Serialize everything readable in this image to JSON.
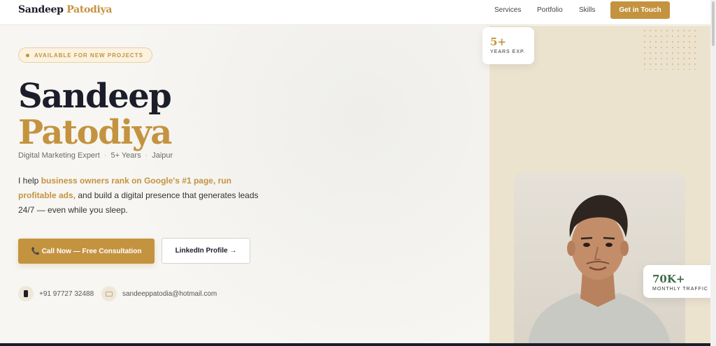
{
  "nav": {
    "brand_first": "Sandeep",
    "brand_last": "Patodiya",
    "links": [
      "Services",
      "Portfolio",
      "Skills"
    ],
    "cta_label": "Get in Touch"
  },
  "hero": {
    "badge": "AVAILABLE FOR NEW PROJECTS",
    "name_line1": "Sandeep",
    "name_line2": "Patodiya",
    "meta": [
      "Digital Marketing Expert",
      "5+ Years",
      "Jaipur"
    ],
    "meta_separator": "·",
    "desc_pre": "I help ",
    "desc_highlight": "business owners rank on Google's #1 page, run profitable ads,",
    "desc_post": " and build a digital presence that generates leads 24/7 — even while you sleep.",
    "primary_button": "📞 Call Now — Free Consultation",
    "secondary_button": "LinkedIn Profile →",
    "phone": "+91 97727 32488",
    "email": "sandeeppatodia@hotmail.com"
  },
  "stats": {
    "experience_value": "5+",
    "experience_label": "YEARS EXP.",
    "traffic_value": "70K+",
    "traffic_label": "MONTHLY TRAFFIC"
  },
  "colors": {
    "accent": "#c4933f",
    "dark": "#1c1d2b",
    "panel": "#ece3cf",
    "traffic_green": "#3f6b47"
  },
  "icons": [
    "phone-icon",
    "mail-icon"
  ]
}
